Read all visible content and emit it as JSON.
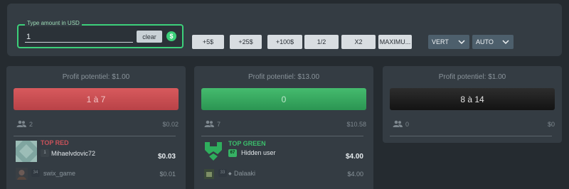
{
  "controls": {
    "amount_legend": "Type amount in USD",
    "amount_value": "1",
    "clear_label": "clear",
    "currency_symbol": "$",
    "quick_buttons": [
      "+5$",
      "+25$",
      "+100$",
      "1/2",
      "X2",
      "MAXIMU..."
    ],
    "layout_select": "VERT",
    "mode_select": "AUTO"
  },
  "panels": [
    {
      "profit": "Profit potentiel: $1.00",
      "bet_label": "1 à 7",
      "color": "red",
      "players_count": "2",
      "total": "$0.02",
      "top_label": "TOP RED",
      "top_player": {
        "level": "1",
        "name": "Mihaelvdovic72",
        "amount": "$0.03"
      },
      "next_player": {
        "level": "34",
        "name": "swix_game",
        "amount": "$0.01"
      }
    },
    {
      "profit": "Profit potentiel: $13.00",
      "bet_label": "0",
      "color": "green",
      "players_count": "7",
      "total": "$10.58",
      "top_label": "TOP GREEN",
      "top_player": {
        "level": "67",
        "name": "Hidden user",
        "amount": "$4.00"
      },
      "next_player": {
        "level": "33",
        "name": "Dalaaki",
        "amount": "$4.00"
      }
    },
    {
      "profit": "Profit potentiel: $1.00",
      "bet_label": "8 à 14",
      "color": "black",
      "players_count": "0",
      "total": "$0"
    }
  ],
  "colors": {
    "background": "#252b30",
    "panel": "#343c43",
    "accent_green": "#3cd07a",
    "red": "#c94e52",
    "green": "#35a962",
    "black": "#1c1c1c",
    "top_red_label": "#c9525a",
    "top_green_label": "#3cbf6c"
  },
  "icons": [
    "dollar-icon",
    "users-icon",
    "chevron-down-icon",
    "shield-icon"
  ]
}
